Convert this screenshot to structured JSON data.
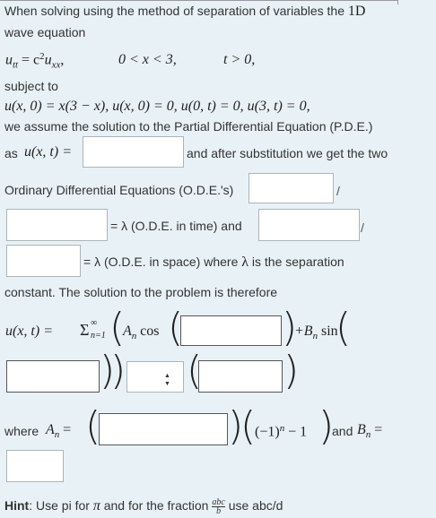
{
  "intro": {
    "line1": "When solving using the method of separation of variables the",
    "dim": "1D",
    "line2": "wave equation"
  },
  "equation": {
    "pde": "u",
    "pde_sub": "tt",
    "pde_rhs": "= c",
    "pde_rhs_sup": "2",
    "pde_rhs_u": "u",
    "pde_rhs_sub": "xx",
    "pde_comma": ",",
    "domain_x": "0 < x < 3,",
    "domain_t": "t > 0,"
  },
  "conditions": {
    "label": "subject to",
    "text": "u(x, 0) = x(3 − x), u(x, 0) = 0,   u(0, t) = 0,   u(3, t) = 0,"
  },
  "assume": {
    "line": "we assume the solution to the Partial Differential Equation (P.D.E.)",
    "as_label": "as",
    "as_math": "u(x, t) =",
    "after_sub": "and after substitution we get the two"
  },
  "ode": {
    "label": "Ordinary Differential Equations (O.D.E.'s)",
    "slash1": "/",
    "eq_time": "= λ (O.D.E. in time) and",
    "slash2": "/",
    "eq_space_lambda": "= λ",
    "eq_space_text": "(O.D.E. in space) where",
    "lambda2": "λ",
    "separation": "is the separation",
    "constant_line": "constant. The solution to the problem is therefore"
  },
  "solution": {
    "lhs": "u(x, t) =",
    "sum": "Σ",
    "sum_top": "∞",
    "sum_bottom": "n=1",
    "An": "A",
    "An_sub": "n",
    "cos": "cos",
    "plus_Bn": "+B",
    "Bn_sub": "n",
    "sin": "sin"
  },
  "select": {
    "glyph_up": "▲",
    "glyph_down": "▼"
  },
  "coeffs": {
    "where_label": "where",
    "An": "A",
    "An_sub": "n",
    "eq": "=",
    "neg1": "(−1)",
    "neg1_sup": "n",
    "minus1": "− 1",
    "and_label": "and",
    "Bn": "B",
    "Bn_sub": "n",
    "Bn_eq": "="
  },
  "hint": {
    "bold": "Hint",
    "text1": ": Use pi for",
    "pi": "π",
    "text2": "and for the fraction",
    "frac_num": "abc",
    "frac_den": "b",
    "text3": "use abc/d"
  }
}
